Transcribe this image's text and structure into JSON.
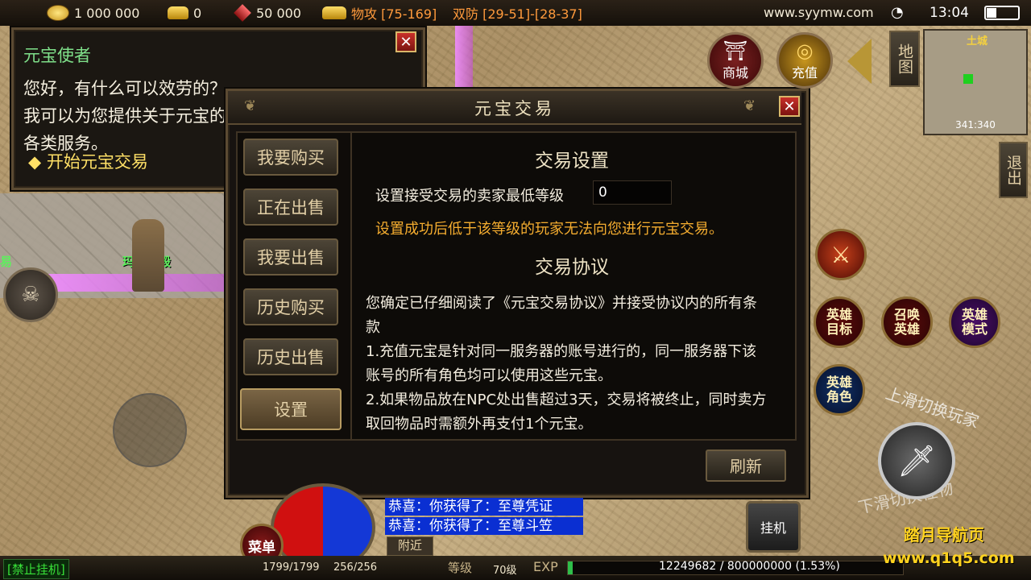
{
  "topbar": {
    "gold": "1 000 000",
    "ingot": "0",
    "gem": "50 000",
    "attack": "物攻 [75-169]",
    "defense": "双防 [29-51]-[28-37]",
    "site": "www.syymw.com",
    "time": "13:04"
  },
  "npc_dialog": {
    "title": "元宝使者",
    "text": "您好，有什么可以效劳的？我可以为您提供关于元宝的各类服务。",
    "option": "开始元宝交易",
    "close": "✕"
  },
  "trade_window": {
    "title": "元宝交易",
    "close": "✕",
    "tabs": [
      {
        "label": "我要购买"
      },
      {
        "label": "正在出售"
      },
      {
        "label": "我要出售"
      },
      {
        "label": "历史购买"
      },
      {
        "label": "历史出售"
      },
      {
        "label": "设置"
      }
    ],
    "settings_heading": "交易设置",
    "min_level_label": "设置接受交易的卖家最低等级",
    "min_level_value": "0",
    "settings_note": "设置成功后低于该等级的玩家无法向您进行元宝交易。",
    "agreement_heading": "交易协议",
    "agreement_text": [
      "您确定已仔细阅读了《元宝交易协议》并接受协议内的所有条款",
      "1.充值元宝是针对同一服务器的账号进行的，同一服务器下该账号的所有角色均可以使用这些元宝。",
      "2.如果物品放在NPC处出售超过3天，交易将被终止，同时卖方取回物品时需额外再支付1个元宝。"
    ],
    "refresh": "刷新"
  },
  "right_hud": {
    "shop": "商城",
    "recharge": "充值",
    "map": "地图",
    "exit": "退出",
    "minimap_region": "土城",
    "minimap_coords": "341:340",
    "hero_target": "英雄目标",
    "summon_hero": "召唤英雄",
    "hero_mode": "英雄模式",
    "hero_role": "英雄角色",
    "swipe_hint_top": "上滑切换玩家",
    "swipe_hint_bottom": "下滑切换怪物"
  },
  "world": {
    "npc_name": "玛雅神殿",
    "edge_label": "易"
  },
  "chat": {
    "lines": [
      "恭喜：你获得了：至尊凭证",
      "恭喜：你获得了：至尊斗笠"
    ],
    "nearby": "附近"
  },
  "bottom": {
    "menu": "菜单",
    "auto": "挂机",
    "no_auto": "[禁止挂机]",
    "hp": "1799/1799",
    "mp": "256/256",
    "level_label": "等级",
    "level": "70级",
    "exp_label": "EXP",
    "exp": "12249682 / 800000000 (1.53%)",
    "exp_fraction": 0.0153,
    "watermark_1": "踏月导航页",
    "watermark_2": "www.q1q5.com"
  }
}
